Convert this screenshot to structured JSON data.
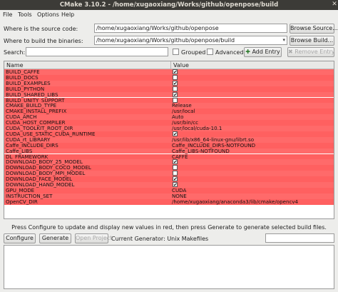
{
  "window": {
    "title": "CMake 3.10.2 - /home/xugaoxiang/Works/github/openpose/build"
  },
  "menu": [
    "File",
    "Tools",
    "Options",
    "Help"
  ],
  "source": {
    "label": "Where is the source code:",
    "value": "/home/xugaoxiang/Works/github/openpose",
    "button": "Browse Source..."
  },
  "binaries": {
    "label": "Where to build the binaries:",
    "value": "/home/xugaoxiang/Works/github/openpose/build",
    "button": "Browse Build..."
  },
  "search": {
    "label": "Search:",
    "value": "",
    "grouped": "Grouped",
    "advanced": "Advanced",
    "add_entry": "Add Entry",
    "remove_entry": "Remove Entry"
  },
  "table": {
    "columns": [
      "Name",
      "Value"
    ],
    "rows": [
      {
        "name": "BUILD_CAFFE",
        "value": "",
        "checkbox": true,
        "checked": true
      },
      {
        "name": "BUILD_DOCS",
        "value": "",
        "checkbox": true,
        "checked": false
      },
      {
        "name": "BUILD_EXAMPLES",
        "value": "",
        "checkbox": true,
        "checked": true
      },
      {
        "name": "BUILD_PYTHON",
        "value": "",
        "checkbox": true,
        "checked": false
      },
      {
        "name": "BUILD_SHARED_LIBS",
        "value": "",
        "checkbox": true,
        "checked": true
      },
      {
        "name": "BUILD_UNITY_SUPPORT",
        "value": "",
        "checkbox": true,
        "checked": false
      },
      {
        "name": "CMAKE_BUILD_TYPE",
        "value": "Release",
        "checkbox": false,
        "checked": false
      },
      {
        "name": "CMAKE_INSTALL_PREFIX",
        "value": "/usr/local",
        "checkbox": false,
        "checked": false
      },
      {
        "name": "CUDA_ARCH",
        "value": "Auto",
        "checkbox": false,
        "checked": false
      },
      {
        "name": "CUDA_HOST_COMPILER",
        "value": "/usr/bin/cc",
        "checkbox": false,
        "checked": false
      },
      {
        "name": "CUDA_TOOLKIT_ROOT_DIR",
        "value": "/usr/local/cuda-10.1",
        "checkbox": false,
        "checked": false
      },
      {
        "name": "CUDA_USE_STATIC_CUDA_RUNTIME",
        "value": "",
        "checkbox": true,
        "checked": true
      },
      {
        "name": "CUDA_rt_LIBRARY",
        "value": "/usr/lib/x86_64-linux-gnu/librt.so",
        "checkbox": false,
        "checked": false
      },
      {
        "name": "Caffe_INCLUDE_DIRS",
        "value": "Caffe_INCLUDE_DIRS-NOTFOUND",
        "checkbox": false,
        "checked": false
      },
      {
        "name": "Caffe_LIBS",
        "value": "Caffe_LIBS-NOTFOUND",
        "checkbox": false,
        "checked": false
      },
      {
        "name": "DL_FRAMEWORK",
        "value": "CAFFE",
        "checkbox": false,
        "checked": false
      },
      {
        "name": "DOWNLOAD_BODY_25_MODEL",
        "value": "",
        "checkbox": true,
        "checked": true
      },
      {
        "name": "DOWNLOAD_BODY_COCO_MODEL",
        "value": "",
        "checkbox": true,
        "checked": false
      },
      {
        "name": "DOWNLOAD_BODY_MPI_MODEL",
        "value": "",
        "checkbox": true,
        "checked": false
      },
      {
        "name": "DOWNLOAD_FACE_MODEL",
        "value": "",
        "checkbox": true,
        "checked": true
      },
      {
        "name": "DOWNLOAD_HAND_MODEL",
        "value": "",
        "checkbox": true,
        "checked": true
      },
      {
        "name": "GPU_MODE",
        "value": "CUDA",
        "checkbox": false,
        "checked": false
      },
      {
        "name": "INSTRUCTION_SET",
        "value": "NONE",
        "checkbox": false,
        "checked": false
      },
      {
        "name": "OpenCV_DIR",
        "value": "/home/xugaoxiang/anaconda3/lib/cmake/opencv4",
        "checkbox": false,
        "checked": false
      }
    ]
  },
  "message": "Press Configure to update and display new values in red, then press Generate to generate selected build files.",
  "bottom": {
    "configure": "Configure",
    "generate": "Generate",
    "open_project": "Open Project",
    "generator": "Current Generator: Unix Makefiles"
  },
  "colors": {
    "row_red": "#ff6a6a",
    "titlebar": "#3c3b37"
  },
  "icons": {
    "close": "close-icon",
    "add": "plus-icon",
    "remove": "minus-icon",
    "combo": "chevron-down-icon",
    "check": "check-icon"
  }
}
